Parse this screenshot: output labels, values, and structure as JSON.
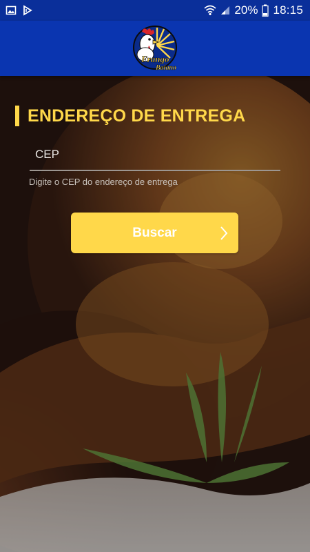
{
  "status_bar": {
    "battery_percent": "20%",
    "time": "18:15",
    "icons": [
      "image-icon",
      "download-icon",
      "wifi-icon",
      "signal-icon",
      "battery-icon"
    ]
  },
  "app_bar": {
    "logo_icon": "frango-logo-icon",
    "logo_text_line1": "Frango",
    "logo_text_line2": "Baiano"
  },
  "delivery": {
    "title": "ENDEREÇO DE ENTREGA",
    "cep_placeholder": "CEP",
    "cep_value": "",
    "helper": "Digite o CEP do endereço de entrega",
    "search_button": "Buscar"
  },
  "colors": {
    "status_bar": "#0a2f9a",
    "app_bar": "#0a35b0",
    "accent": "#ffd84a",
    "text_white": "#ffffff"
  }
}
